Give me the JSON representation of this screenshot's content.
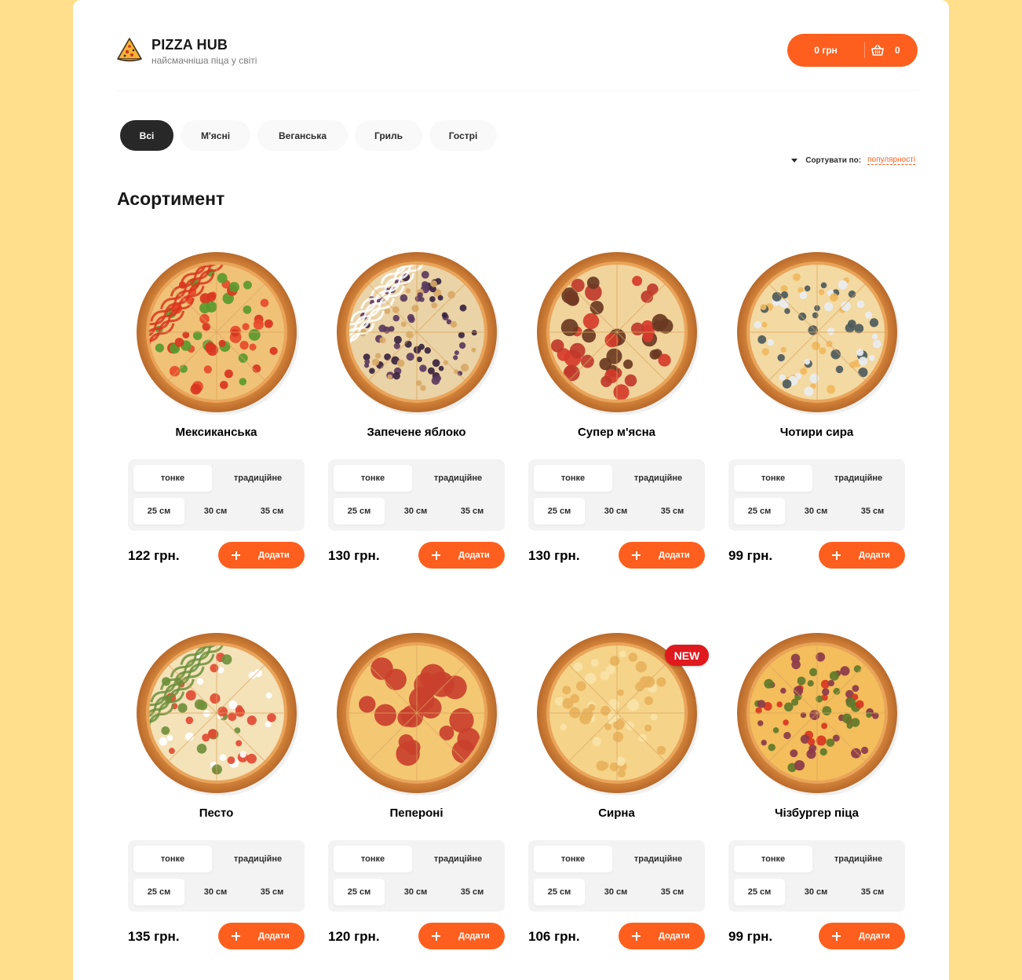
{
  "header": {
    "title": "PIZZA HUB",
    "subtitle": "найсмачніша піца у світі",
    "cart_price": "0 грн",
    "cart_count": "0"
  },
  "categories": [
    "Всі",
    "М'ясні",
    "Веганська",
    "Гриль",
    "Гострі"
  ],
  "active_category": "Всі",
  "sort": {
    "label": "Сортувати по:",
    "value": "популярності"
  },
  "section_title": "Асортимент",
  "types": [
    "тонке",
    "традиційне"
  ],
  "sizes": [
    "25 см",
    "30 см",
    "35 см"
  ],
  "add_label": "Додати",
  "badge_new": "NEW",
  "pizzas": [
    {
      "name": "Мексиканська",
      "price": "122 грн.",
      "style": "mexican"
    },
    {
      "name": "Запечене яблоко",
      "price": "130 грн.",
      "style": "apple"
    },
    {
      "name": "Супер м'ясна",
      "price": "130 грн.",
      "style": "meat"
    },
    {
      "name": "Чотири сира",
      "price": "99 грн.",
      "style": "cheese4"
    },
    {
      "name": "Песто",
      "price": "135 грн.",
      "style": "pesto"
    },
    {
      "name": "Пепероні",
      "price": "120 грн.",
      "style": "pepperoni"
    },
    {
      "name": "Сирна",
      "price": "106 грн.",
      "style": "cheese",
      "is_new": true
    },
    {
      "name": "Чізбургер піца",
      "price": "99 грн.",
      "style": "cheeseburger"
    }
  ],
  "colors": {
    "accent": "#fe5f1e",
    "background": "#ffdf8c",
    "badge": "#e0191e"
  }
}
